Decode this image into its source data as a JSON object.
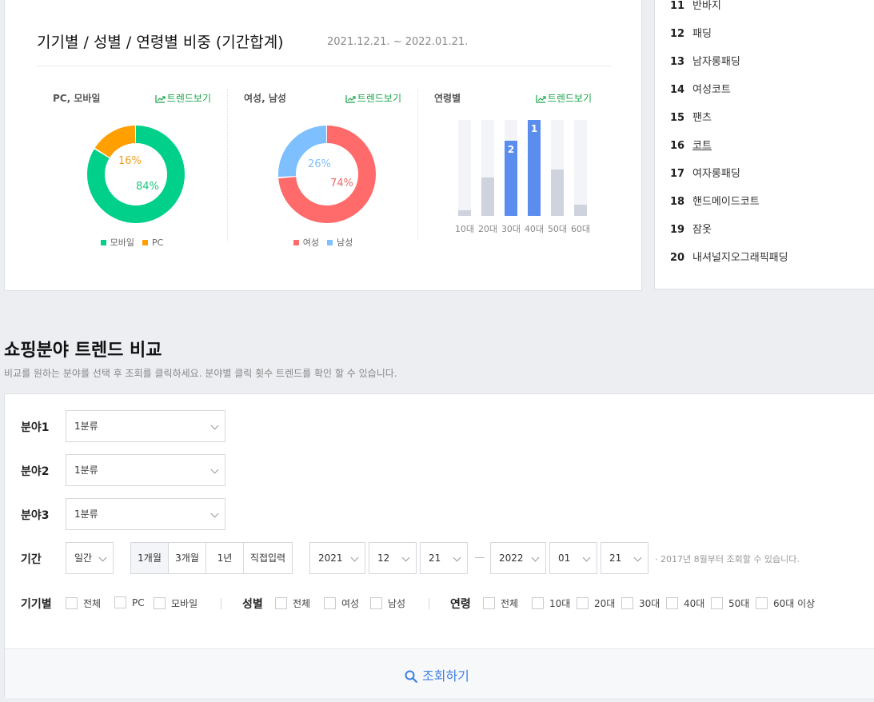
{
  "ratio": {
    "title": "기기별 / 성별 / 연령별 비중 (기간합계)",
    "date_range": "2021.12.21. ~ 2022.01.21.",
    "trend_link": "트렌드보기",
    "device": {
      "label": "PC, 모바일",
      "mobile_pct": "84%",
      "pc_pct": "16%",
      "mobile_value": 84,
      "pc_value": 16,
      "legend": [
        "모바일",
        "PC"
      ],
      "colors": {
        "mobile": "#00d08a",
        "pc": "#ff9f00"
      }
    },
    "gender": {
      "label": "여성, 남성",
      "female_pct": "74%",
      "male_pct": "26%",
      "female_value": 74,
      "male_value": 26,
      "legend": [
        "여성",
        "남성"
      ],
      "colors": {
        "female": "#ff6b6b",
        "male": "#7ec0ff"
      }
    },
    "age": {
      "label": "연령별",
      "categories": [
        "10대",
        "20대",
        "30대",
        "40대",
        "50대",
        "60대"
      ],
      "values": [
        0.06,
        0.4,
        0.78,
        1.0,
        0.48,
        0.12
      ],
      "ranks": [
        "",
        "",
        "2",
        "1",
        "",
        ""
      ],
      "highlight_color": "#5b8def"
    }
  },
  "ranking": [
    {
      "num": "11",
      "name": "반바지"
    },
    {
      "num": "12",
      "name": "패딩"
    },
    {
      "num": "13",
      "name": "남자롱패딩"
    },
    {
      "num": "14",
      "name": "여성코트"
    },
    {
      "num": "15",
      "name": "팬츠"
    },
    {
      "num": "16",
      "name": "코트"
    },
    {
      "num": "17",
      "name": "여자롱패딩"
    },
    {
      "num": "18",
      "name": "핸드메이드코트"
    },
    {
      "num": "19",
      "name": "잠옷"
    },
    {
      "num": "20",
      "name": "내셔널지오그래픽패딩"
    }
  ],
  "compare": {
    "title": "쇼핑분야 트렌드 비교",
    "description": "비교를 원하는 분야를 선택 후 조회를 클릭하세요. 분야별 클릭 횟수 트렌드를 확인 할 수 있습니다.",
    "field1_label": "분야1",
    "field2_label": "분야2",
    "field3_label": "분야3",
    "field_value": "1분류",
    "period_label": "기간",
    "period_unit": "일간",
    "period_buttons": [
      "1개월",
      "3개월",
      "1년",
      "직접입력"
    ],
    "start": {
      "year": "2021",
      "month": "12",
      "day": "21"
    },
    "end": {
      "year": "2022",
      "month": "01",
      "day": "21"
    },
    "period_note": "· 2017년 8월부터 조회할 수 있습니다.",
    "device_label": "기기별",
    "device_options": [
      "전체",
      "PC",
      "모바일"
    ],
    "gender_label": "성별",
    "gender_options": [
      "전체",
      "여성",
      "남성"
    ],
    "age_label": "연령",
    "age_options": [
      "전체",
      "10대",
      "20대",
      "30대",
      "40대",
      "50대",
      "60대 이상"
    ],
    "search_button": "조회하기"
  }
}
